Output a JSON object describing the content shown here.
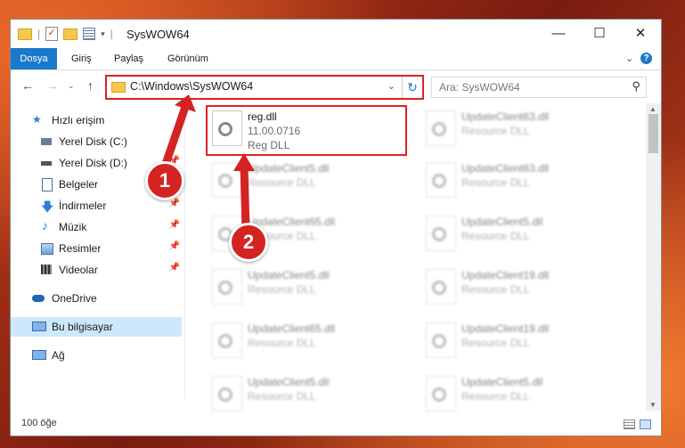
{
  "window": {
    "title": "SysWOW64"
  },
  "ribbon": {
    "tabs": [
      {
        "label": "Dosya",
        "active": true
      },
      {
        "label": "Giriş"
      },
      {
        "label": "Paylaş"
      },
      {
        "label": "Görünüm"
      }
    ],
    "help": "?"
  },
  "nav": {
    "address": "C:\\Windows\\SysWOW64",
    "search_placeholder": "Ara: SysWOW64"
  },
  "sidebar": {
    "items": [
      {
        "label": "Hızlı erişim",
        "icon": "star-icon"
      },
      {
        "label": "Yerel Disk (C:)",
        "icon": "drive-icon"
      },
      {
        "label": "Yerel Disk (D:)",
        "icon": "drive-icon"
      },
      {
        "label": "Belgeler",
        "icon": "documents-icon"
      },
      {
        "label": "İndirmeler",
        "icon": "download-icon"
      },
      {
        "label": "Müzik",
        "icon": "music-icon"
      },
      {
        "label": "Resimler",
        "icon": "pictures-icon"
      },
      {
        "label": "Videolar",
        "icon": "video-icon"
      },
      {
        "label": "OneDrive",
        "icon": "cloud-icon"
      },
      {
        "label": "Bu bilgisayar",
        "icon": "computer-icon"
      },
      {
        "label": "Ağ",
        "icon": "network-icon"
      }
    ]
  },
  "files": {
    "selected": {
      "name": "reg.dll",
      "version": "11.00.0716",
      "type": "Reg DLL"
    },
    "col1": [
      {
        "name": "UpdateClient5.dll",
        "type": "Resource DLL"
      },
      {
        "name": "UpdateClient65.dll",
        "type": "Resource DLL"
      },
      {
        "name": "UpdateClient5.dll",
        "type": "Resource DLL"
      },
      {
        "name": "UpdateClient65.dll",
        "type": "Resource DLL"
      },
      {
        "name": "UpdateClient5.dll",
        "type": "Resource DLL"
      }
    ],
    "col2": [
      {
        "name": "UpdateClient63.dll",
        "type": "Resource DLL"
      },
      {
        "name": "UpdateClient63.dll",
        "type": "Resource DLL"
      },
      {
        "name": "UpdateClient5.dll",
        "type": "Resource DLL"
      },
      {
        "name": "UpdateClient19.dll",
        "type": "Resource DLL"
      },
      {
        "name": "UpdateClient19.dll",
        "type": "Resource DLL"
      },
      {
        "name": "UpdateClient5.dll",
        "type": "Resource DLL"
      }
    ]
  },
  "status": {
    "count": "100 öğe"
  },
  "annotations": {
    "badge1": "1",
    "badge2": "2",
    "color": "#d42422"
  }
}
